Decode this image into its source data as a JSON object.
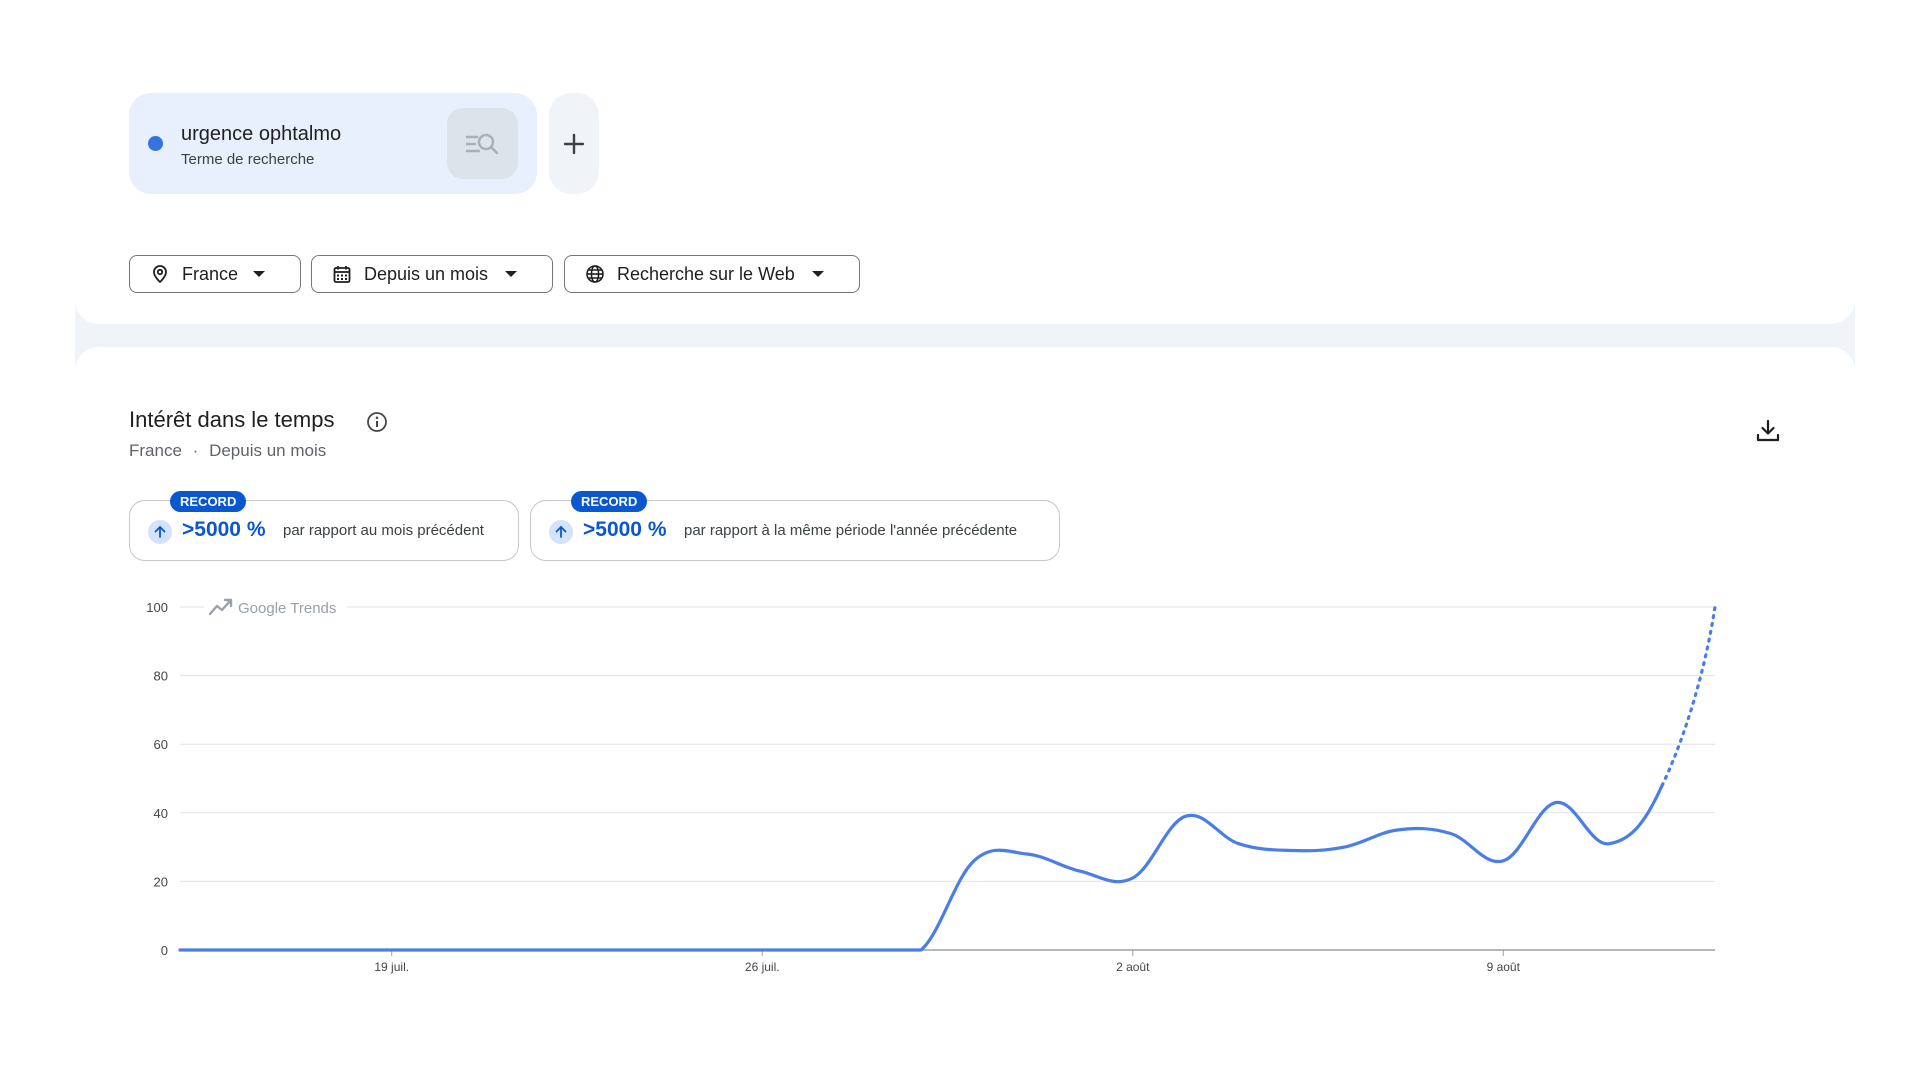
{
  "search_term": {
    "name": "urgence ophtalmo",
    "type": "Terme de recherche",
    "color": "#3871e0"
  },
  "add_term_label": "+",
  "filters": {
    "location": "France",
    "period": "Depuis un mois",
    "search_type": "Recherche sur le Web"
  },
  "interest_section": {
    "title": "Intérêt dans le temps",
    "subtitle_location": "France",
    "subtitle_separator": "·",
    "subtitle_period": "Depuis un mois"
  },
  "stats": [
    {
      "badge": "RECORD",
      "value": ">5000 %",
      "description": "par rapport au mois précédent"
    },
    {
      "badge": "RECORD",
      "value": ">5000 %",
      "description": "par rapport à la même période l'année précédente"
    }
  ],
  "watermark": "Google Trends",
  "chart_data": {
    "type": "line",
    "x_ticks": [
      "19 juil.",
      "26 juil.",
      "2 août",
      "9 août"
    ],
    "y_ticks": [
      0,
      20,
      40,
      60,
      80,
      100
    ],
    "ylim": [
      0,
      100
    ],
    "grid": true,
    "series": [
      {
        "color": "#4a7ee6",
        "x": [
          0,
          1,
          2,
          3,
          4,
          5,
          6,
          7,
          8,
          9,
          10,
          11,
          12,
          13,
          14,
          15,
          16,
          17,
          18,
          19,
          20,
          21,
          22,
          23,
          24,
          25,
          26,
          27,
          28,
          29
        ],
        "values": [
          0,
          0,
          0,
          0,
          0,
          0,
          0,
          0,
          0,
          0,
          0,
          0,
          0,
          0,
          0,
          26,
          28,
          23,
          21,
          39,
          31,
          29,
          30,
          35,
          34,
          26,
          43,
          31,
          48,
          100
        ],
        "partial_from_index": 28
      }
    ]
  }
}
